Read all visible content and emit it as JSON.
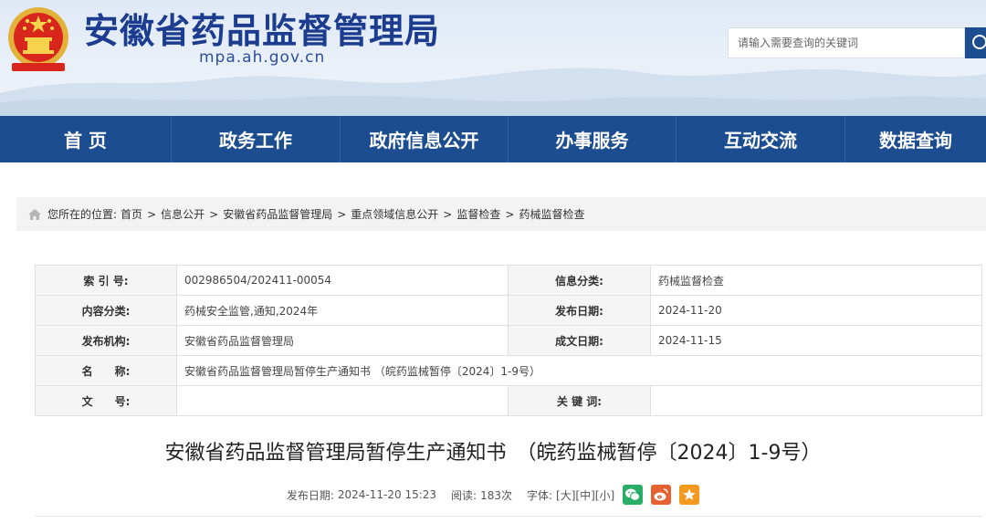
{
  "header": {
    "title": "安徽省药品监督管理局",
    "domain": "mpa.ah.gov.cn",
    "search_placeholder": "请输入需要查询的关键词",
    "emblem_icon": "national-emblem-icon",
    "search_icon": "search-icon"
  },
  "nav": {
    "items": [
      {
        "label": "首 页"
      },
      {
        "label": "政务工作"
      },
      {
        "label": "政府信息公开"
      },
      {
        "label": "办事服务"
      },
      {
        "label": "互动交流"
      },
      {
        "label": "数据查询"
      }
    ]
  },
  "breadcrumb": {
    "prefix": "您所在的位置:",
    "items": [
      "首页",
      "信息公开",
      "安徽省药品监督管理局",
      "重点领域信息公开",
      "监督检查",
      "药械监督检查"
    ],
    "separator": ">"
  },
  "info": {
    "rows": [
      {
        "l1": "索 引 号:",
        "v1": "002986504/202411-00054",
        "l2": "信息分类:",
        "v2": "药械监督检查"
      },
      {
        "l1": "内容分类:",
        "v1": "药械安全监管,通知,2024年",
        "l2": "发布日期:",
        "v2": "2024-11-20"
      },
      {
        "l1": "发布机构:",
        "v1": "安徽省药品监督管理局",
        "l2": "成文日期:",
        "v2": "2024-11-15"
      },
      {
        "l1": "名　　称:",
        "v1": "安徽省药品监督管理局暂停生产通知书 （皖药监械暂停〔2024〕1-9号）"
      },
      {
        "l1": "文　　号:",
        "v1": "",
        "l2": "关 键 词:",
        "v2": ""
      }
    ]
  },
  "article": {
    "title": "安徽省药品监督管理局暂停生产通知书　（皖药监械暂停〔2024〕1-9号）",
    "publish_label": "发布日期:",
    "publish_date": "2024-11-20 15:23",
    "read_label": "阅读:",
    "read_count": "183次",
    "font_label": "字体:",
    "font_large": "[大]",
    "font_medium": "[中]",
    "font_small": "[小]",
    "share": {
      "wechat_color": "#2aae67",
      "weibo_color": "#e6612f",
      "favorite_color": "#f39a1e"
    }
  }
}
